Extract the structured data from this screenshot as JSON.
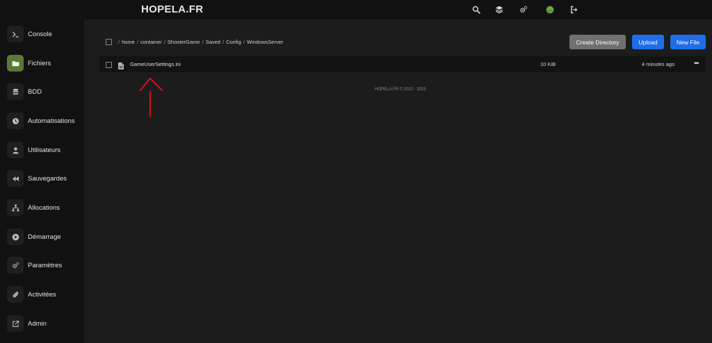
{
  "header": {
    "brand": "HOPELA.FR",
    "icons": [
      "search-icon",
      "layers-icon",
      "cogs-icon",
      "avatar",
      "logout-icon"
    ]
  },
  "sidebar": {
    "items": [
      {
        "label": "Console",
        "icon": "terminal-icon",
        "active": false
      },
      {
        "label": "Fichiers",
        "icon": "folder-icon",
        "active": true
      },
      {
        "label": "BDD",
        "icon": "database-icon",
        "active": false
      },
      {
        "label": "Automatisations",
        "icon": "clock-icon",
        "active": false
      },
      {
        "label": "Utilisateurs",
        "icon": "user-icon",
        "active": false
      },
      {
        "label": "Sauvegardes",
        "icon": "rewind-icon",
        "active": false
      },
      {
        "label": "Allocations",
        "icon": "network-icon",
        "active": false
      },
      {
        "label": "Démarrage",
        "icon": "play-icon",
        "active": false
      },
      {
        "label": "Paramètres",
        "icon": "cogs-icon",
        "active": false
      },
      {
        "label": "Activitées",
        "icon": "paperclip-icon",
        "active": false
      },
      {
        "label": "Admin",
        "icon": "external-link-icon",
        "active": false
      }
    ]
  },
  "breadcrumb": {
    "parts": [
      "home",
      "container",
      "ShooterGame",
      "Saved",
      "Config",
      "WindowsServer"
    ]
  },
  "toolbar": {
    "create_directory": "Create Directory",
    "upload": "Upload",
    "new_file": "New File"
  },
  "files": [
    {
      "name": "GameUserSettings.ini",
      "size": "10 KiB",
      "modified": "4 minutes ago",
      "menu": "•••"
    }
  ],
  "footer": {
    "text": "HOPELA.FR © 2022 - 2025"
  },
  "colors": {
    "accent_blue": "#1f6de8",
    "active_green": "#5a7a3a",
    "annotation_red": "#c4161c"
  }
}
